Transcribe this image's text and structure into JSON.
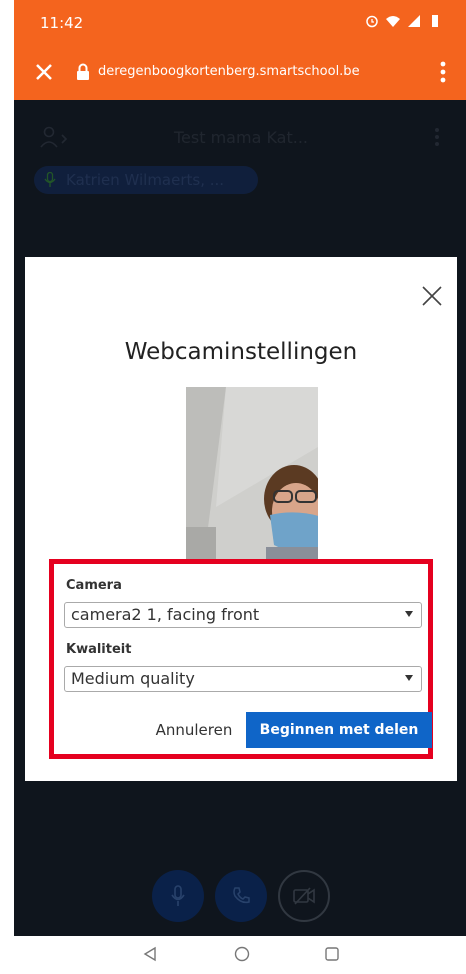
{
  "status_bar": {
    "time": "11:42"
  },
  "browser": {
    "url": "deregenboogkortenberg.smartschool.be"
  },
  "app": {
    "title": "Test mama Kat...",
    "participant_chip": "Katrien Wilmaerts, ..."
  },
  "modal": {
    "title": "Webcaminstellingen",
    "camera_label": "Camera",
    "camera_value": "camera2 1, facing front",
    "quality_label": "Kwaliteit",
    "quality_value": "Medium quality",
    "cancel_label": "Annuleren",
    "start_label": "Beginnen met delen"
  },
  "colors": {
    "accent_orange": "#f4641e",
    "app_bg": "#1d2735",
    "primary_blue": "#0f65c8",
    "highlight_red": "#e5001f"
  },
  "icons": {
    "status": [
      "alarm-icon",
      "wifi-icon",
      "signal-icon",
      "battery-icon"
    ],
    "controls": [
      "microphone-icon",
      "phone-icon",
      "camera-off-icon"
    ],
    "nav": [
      "back-icon",
      "home-icon",
      "recent-apps-icon"
    ]
  }
}
